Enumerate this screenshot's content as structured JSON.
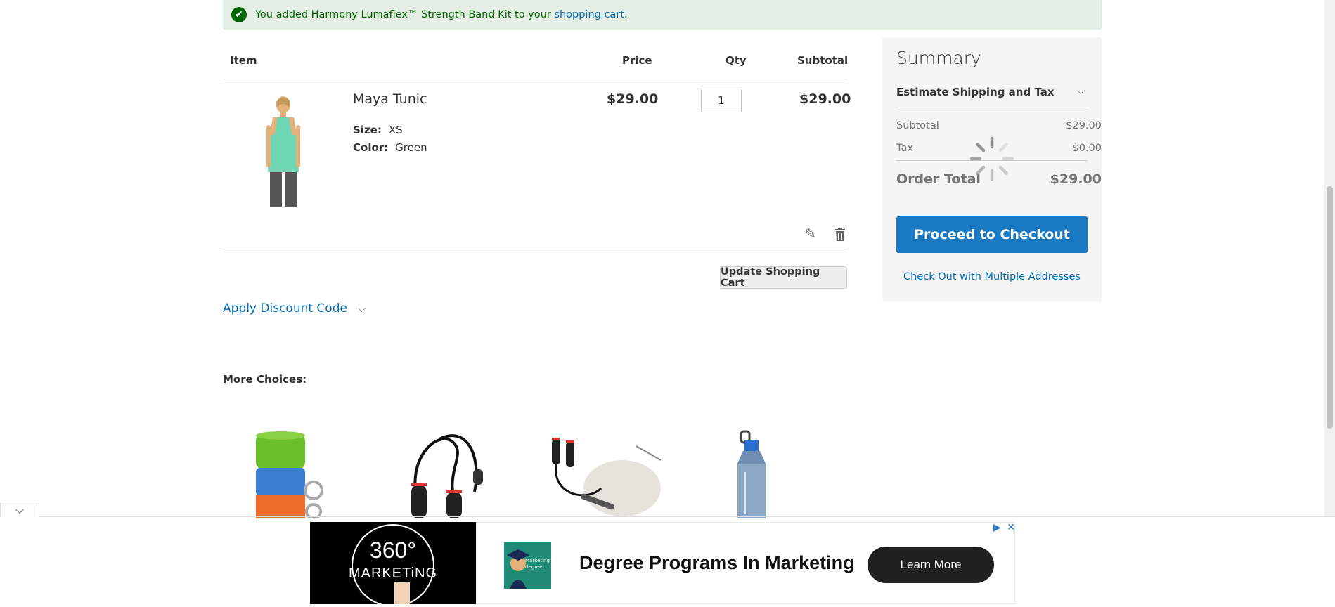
{
  "message": {
    "prefix": "You added Harmony Lumaflex™ Strength Band Kit to your ",
    "link": "shopping cart",
    "suffix": "."
  },
  "cart": {
    "headers": {
      "item": "Item",
      "price": "Price",
      "qty": "Qty",
      "subtotal": "Subtotal"
    },
    "item": {
      "name": "Maya Tunic",
      "size_label": "Size:",
      "size_value": "XS",
      "color_label": "Color:",
      "color_value": "Green",
      "price": "$29.00",
      "qty": "1",
      "subtotal": "$29.00"
    },
    "update_button": "Update Shopping Cart",
    "discount_link": "Apply Discount Code",
    "more_choices": "More Choices:"
  },
  "summary": {
    "title": "Summary",
    "estimate": "Estimate Shipping and Tax",
    "subtotal_label": "Subtotal",
    "subtotal_value": "$29.00",
    "tax_label": "Tax",
    "tax_value": "$0.00",
    "total_label": "Order Total",
    "total_value": "$29.00",
    "checkout_button": "Proceed to Checkout",
    "multi_link": "Check Out with Multiple Addresses"
  },
  "ad": {
    "logo_number": "360°",
    "logo_text": "MARKETiNG",
    "thumb_text": "Marketing degree",
    "headline": "Degree Programs In Marketing",
    "cta": "Learn More"
  },
  "colors": {
    "accent": "#1979c3",
    "link": "#006bb4",
    "success_bg": "#e5efe5",
    "success_text": "#006400"
  }
}
